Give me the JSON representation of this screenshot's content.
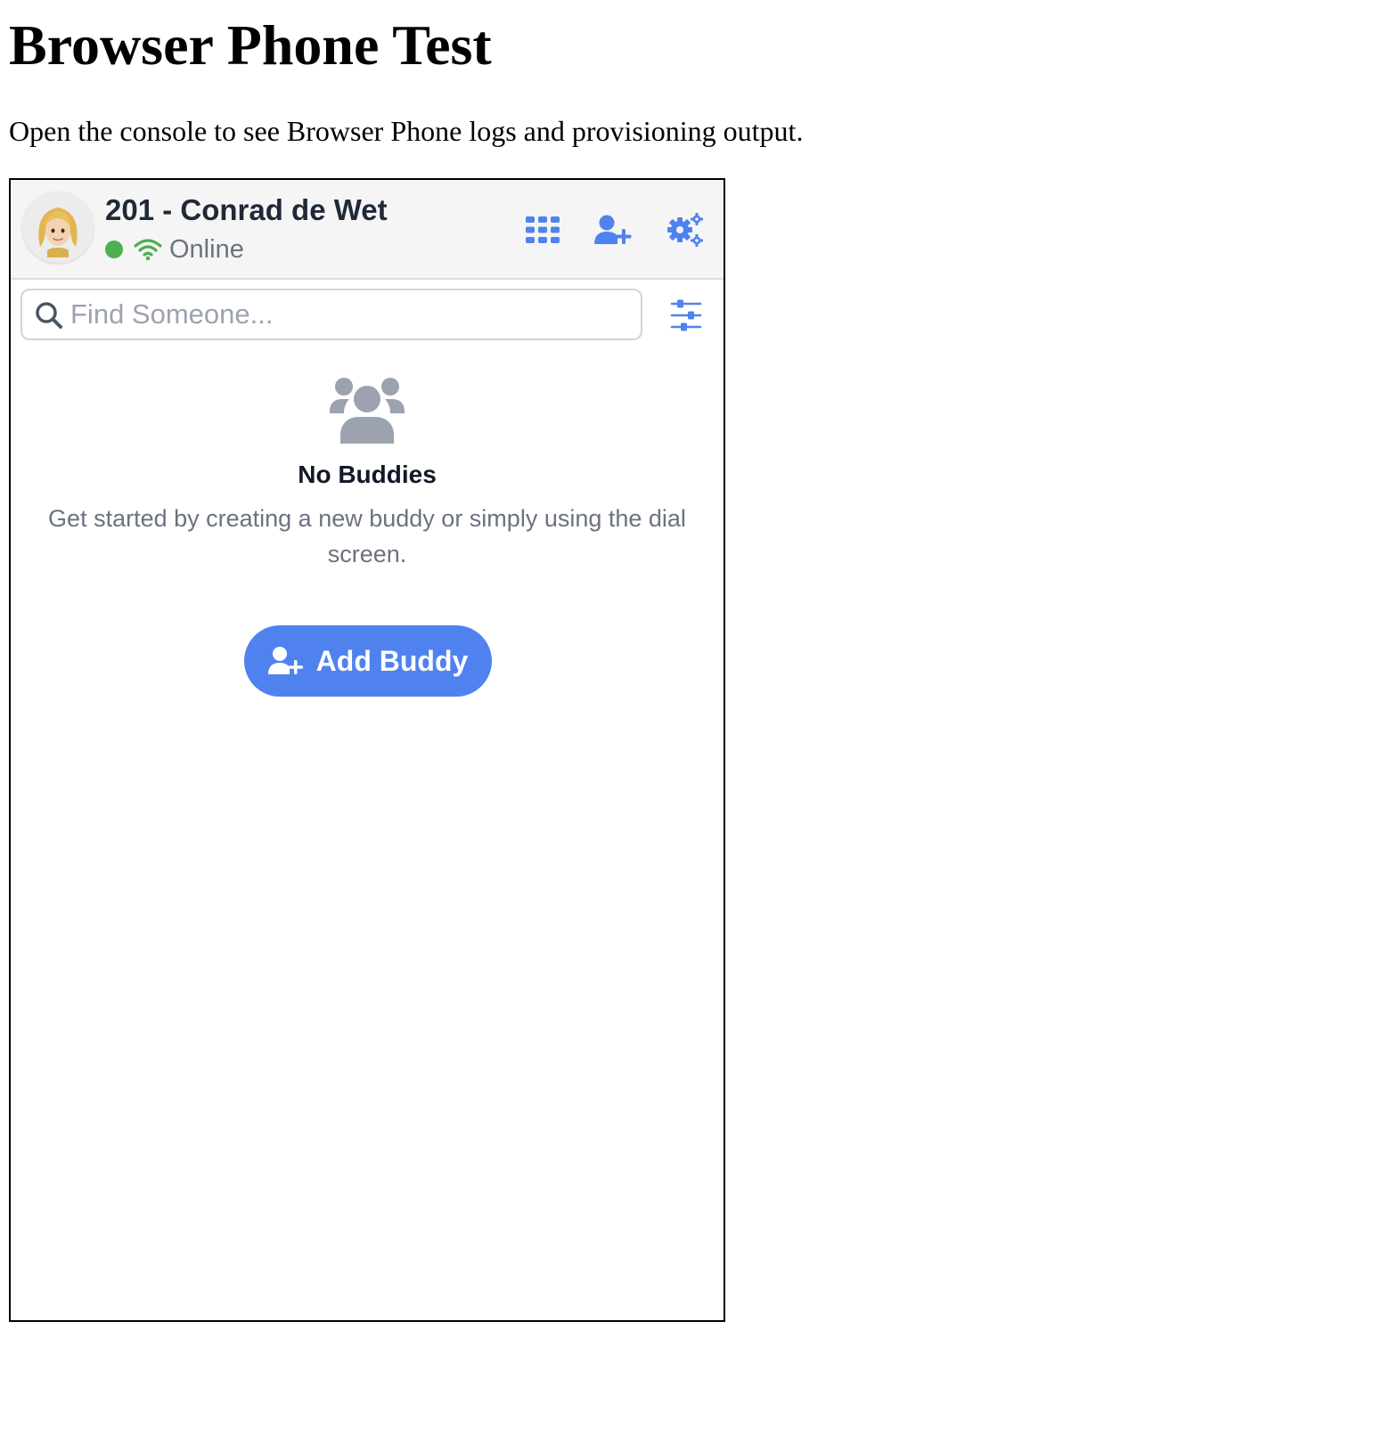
{
  "page": {
    "title": "Browser Phone Test",
    "intro": "Open the console to see Browser Phone logs and provisioning output."
  },
  "phone": {
    "profile": {
      "name": "201 - Conrad de Wet",
      "status": "Online",
      "status_color": "#4caf50"
    },
    "toolbar": {
      "dialpad_icon": "dialpad-grid-icon",
      "add_contact_icon": "user-plus-icon",
      "settings_icon": "gears-icon",
      "accent_color": "#5082ef"
    },
    "search": {
      "placeholder": "Find Someone...",
      "value": ""
    },
    "empty_state": {
      "icon": "users-group-icon",
      "title": "No Buddies",
      "description": "Get started by creating a new buddy or simply using the dial screen."
    },
    "add_buddy": {
      "label": "Add Buddy",
      "icon": "user-plus-icon"
    }
  }
}
